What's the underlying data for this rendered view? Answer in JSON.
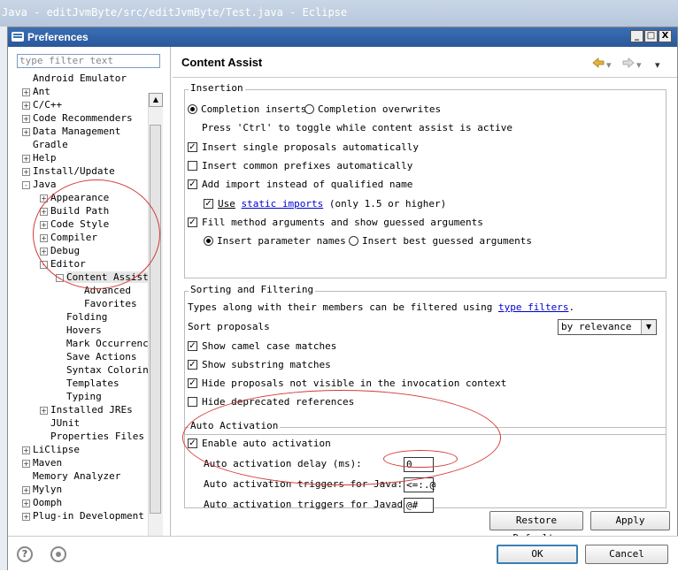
{
  "eclipse_title": "Java - editJvmByte/src/editJvmByte/Test.java - Eclipse",
  "dialog": {
    "title": "Preferences",
    "minimize": "_",
    "maximize": "□",
    "close": "X"
  },
  "filter": {
    "placeholder": "type filter text"
  },
  "tree": [
    {
      "label": "Android Emulator",
      "level": 0,
      "expander": ""
    },
    {
      "label": "Ant",
      "level": 0,
      "expander": "+"
    },
    {
      "label": "C/C++",
      "level": 0,
      "expander": "+"
    },
    {
      "label": "Code Recommenders",
      "level": 0,
      "expander": "+"
    },
    {
      "label": "Data Management",
      "level": 0,
      "expander": "+"
    },
    {
      "label": "Gradle",
      "level": 0,
      "expander": ""
    },
    {
      "label": "Help",
      "level": 0,
      "expander": "+"
    },
    {
      "label": "Install/Update",
      "level": 0,
      "expander": "+"
    },
    {
      "label": "Java",
      "level": 0,
      "expander": "-"
    },
    {
      "label": "Appearance",
      "level": 1,
      "expander": "+"
    },
    {
      "label": "Build Path",
      "level": 1,
      "expander": "+"
    },
    {
      "label": "Code Style",
      "level": 1,
      "expander": "+"
    },
    {
      "label": "Compiler",
      "level": 1,
      "expander": "+"
    },
    {
      "label": "Debug",
      "level": 1,
      "expander": "+"
    },
    {
      "label": "Editor",
      "level": 1,
      "expander": "-"
    },
    {
      "label": "Content Assist",
      "level": 2,
      "expander": "-",
      "selected": true
    },
    {
      "label": "Advanced",
      "level": 3,
      "expander": ""
    },
    {
      "label": "Favorites",
      "level": 3,
      "expander": ""
    },
    {
      "label": "Folding",
      "level": 2,
      "expander": ""
    },
    {
      "label": "Hovers",
      "level": 2,
      "expander": ""
    },
    {
      "label": "Mark Occurrence",
      "level": 2,
      "expander": ""
    },
    {
      "label": "Save Actions",
      "level": 2,
      "expander": ""
    },
    {
      "label": "Syntax Coloring",
      "level": 2,
      "expander": ""
    },
    {
      "label": "Templates",
      "level": 2,
      "expander": ""
    },
    {
      "label": "Typing",
      "level": 2,
      "expander": ""
    },
    {
      "label": "Installed JREs",
      "level": 1,
      "expander": "+"
    },
    {
      "label": "JUnit",
      "level": 1,
      "expander": ""
    },
    {
      "label": "Properties Files E",
      "level": 1,
      "expander": ""
    },
    {
      "label": "LiClipse",
      "level": 0,
      "expander": "+"
    },
    {
      "label": "Maven",
      "level": 0,
      "expander": "+"
    },
    {
      "label": "Memory Analyzer",
      "level": 0,
      "expander": ""
    },
    {
      "label": "Mylyn",
      "level": 0,
      "expander": "+"
    },
    {
      "label": "Oomph",
      "level": 0,
      "expander": "+"
    },
    {
      "label": "Plug-in Development",
      "level": 0,
      "expander": "+"
    }
  ],
  "page": {
    "title": "Content Assist"
  },
  "insertion": {
    "label": "Insertion",
    "completion_inserts": "Completion inserts",
    "completion_overwrites": "Completion overwrites",
    "toggle_hint": "Press 'Ctrl' to toggle while content assist is active",
    "insert_single": "Insert single proposals automatically",
    "insert_common": "Insert common prefixes automatically",
    "add_import": "Add import instead of qualified name",
    "use": "Use",
    "static_imports": "static imports",
    "only15": "(only 1.5 or higher)",
    "fill_method": "Fill method arguments and show guessed arguments",
    "insert_param_names": "Insert parameter names",
    "insert_best_guessed": "Insert best guessed arguments"
  },
  "sorting": {
    "label": "Sorting and Filtering",
    "types_text": "Types along with their members can be filtered using",
    "type_filters": "type filters",
    "period": ".",
    "sort_proposals": "Sort proposals",
    "sort_value": "by relevance",
    "camel_case": "Show camel case matches",
    "substring": "Show substring matches",
    "hide_not_visible": "Hide proposals not visible in the invocation context",
    "hide_deprecated": "Hide deprecated references"
  },
  "auto": {
    "label": "Auto Activation",
    "enable": "Enable auto activation",
    "delay_label": "Auto activation delay (ms):",
    "delay_value": "0",
    "java_label": "Auto activation triggers for Java:",
    "java_value": "<=:.@",
    "javadoc_label": "Auto activation triggers for Javadoc:",
    "javadoc_value": "@#"
  },
  "buttons": {
    "restore": "Restore Defaults",
    "apply": "Apply",
    "ok": "OK",
    "cancel": "Cancel"
  },
  "icons": {
    "help": "?"
  }
}
